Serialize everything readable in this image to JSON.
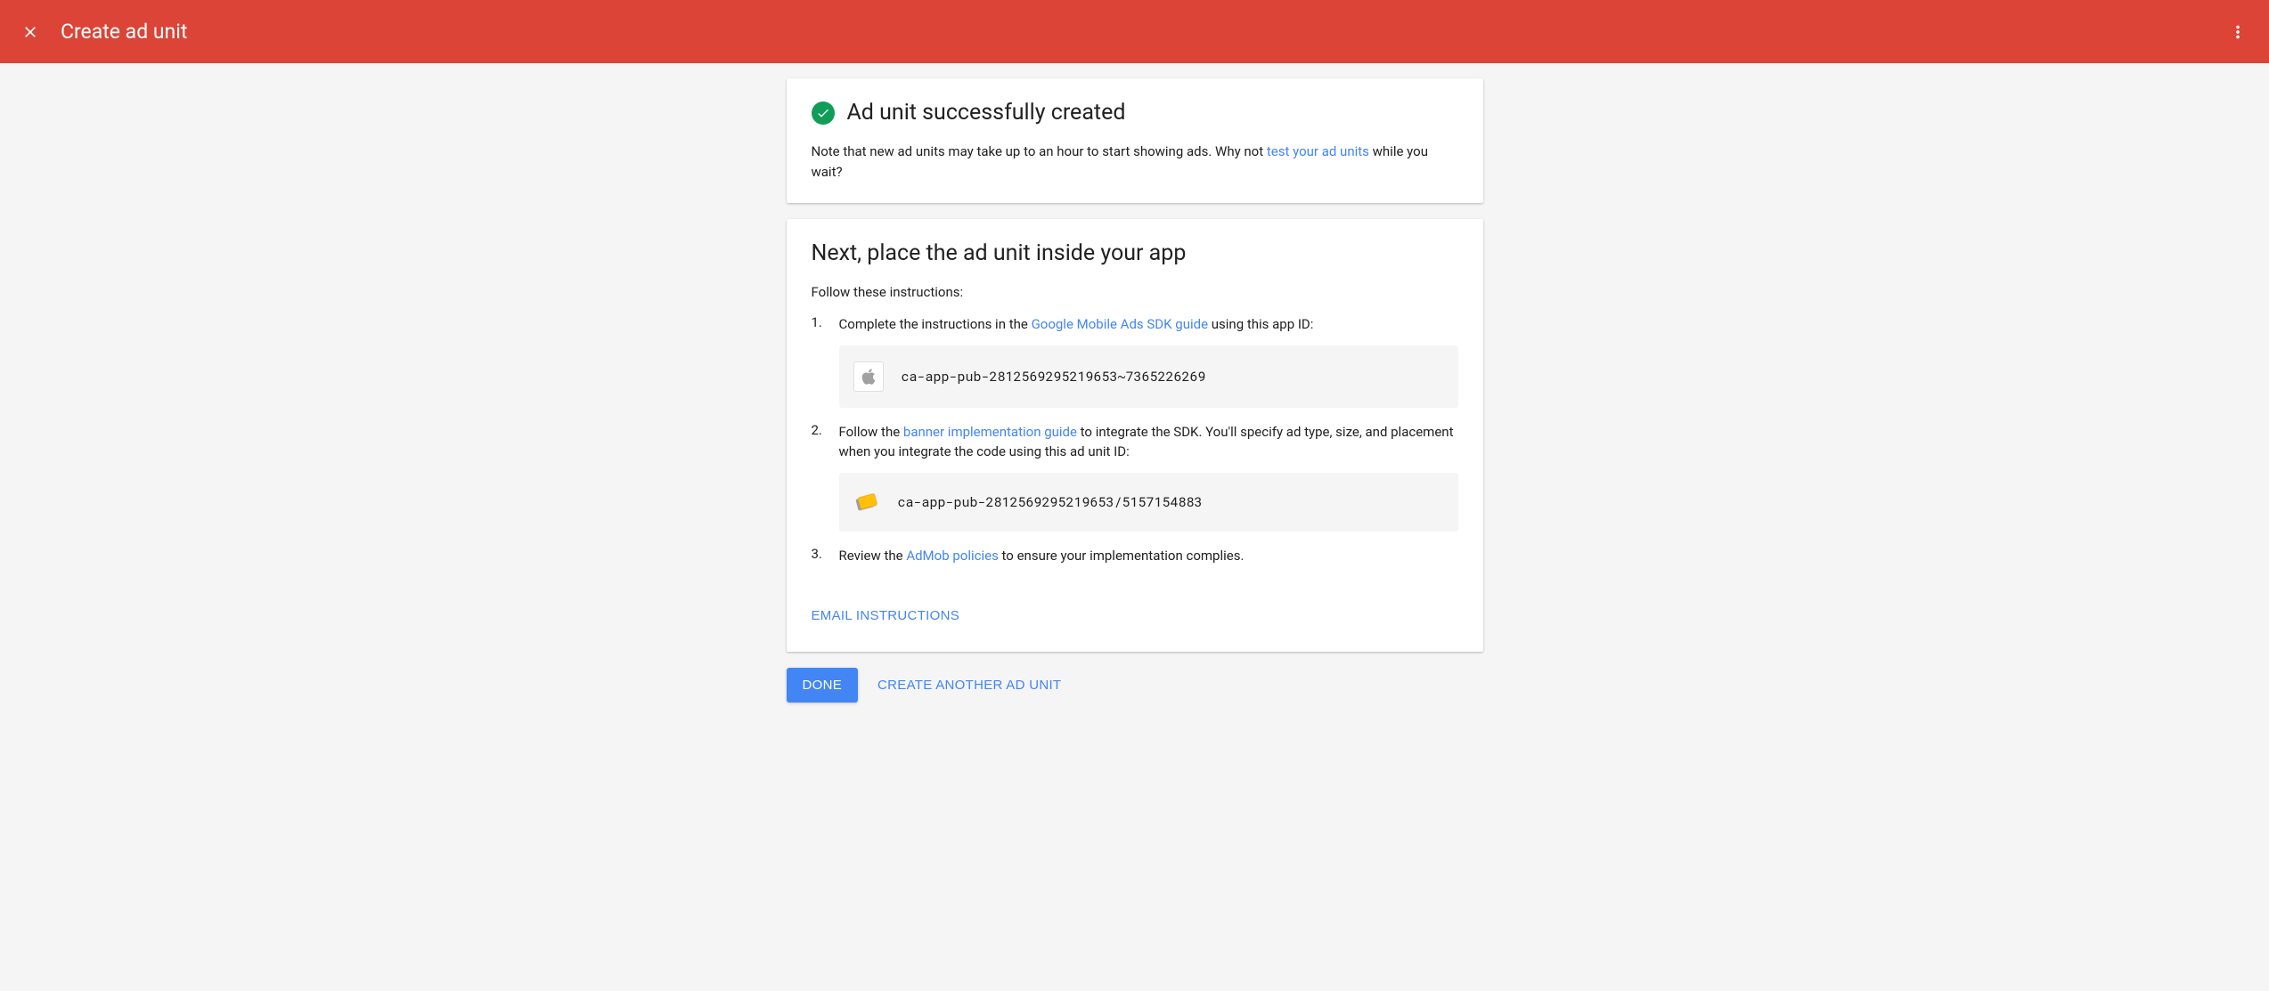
{
  "header": {
    "title": "Create ad unit"
  },
  "success_card": {
    "title": "Ad unit successfully created",
    "note_before": "Note that new ad units may take up to an hour to start showing ads.  Why not ",
    "link_text": "test your ad units",
    "note_after": " while you wait?"
  },
  "next_card": {
    "title": "Next, place the ad unit inside your app",
    "follow_text": "Follow these instructions:",
    "instructions": [
      {
        "number": "1.",
        "text_before": "Complete the instructions in the ",
        "link_text": "Google Mobile Ads SDK guide",
        "text_after": " using this app ID:",
        "code": "ca-app-pub-2812569295219653~7365226269"
      },
      {
        "number": "2.",
        "text_before": "Follow the ",
        "link_text": "banner implementation guide",
        "text_after": " to integrate the SDK. You'll specify ad type, size, and placement when you integrate the code using this ad unit ID:",
        "code": "ca-app-pub-2812569295219653/5157154883"
      },
      {
        "number": "3.",
        "text_before": "Review the ",
        "link_text": "AdMob policies",
        "text_after": " to ensure your implementation complies."
      }
    ],
    "email_button": "EMAIL INSTRUCTIONS"
  },
  "buttons": {
    "done": "DONE",
    "create_another": "CREATE ANOTHER AD UNIT"
  }
}
